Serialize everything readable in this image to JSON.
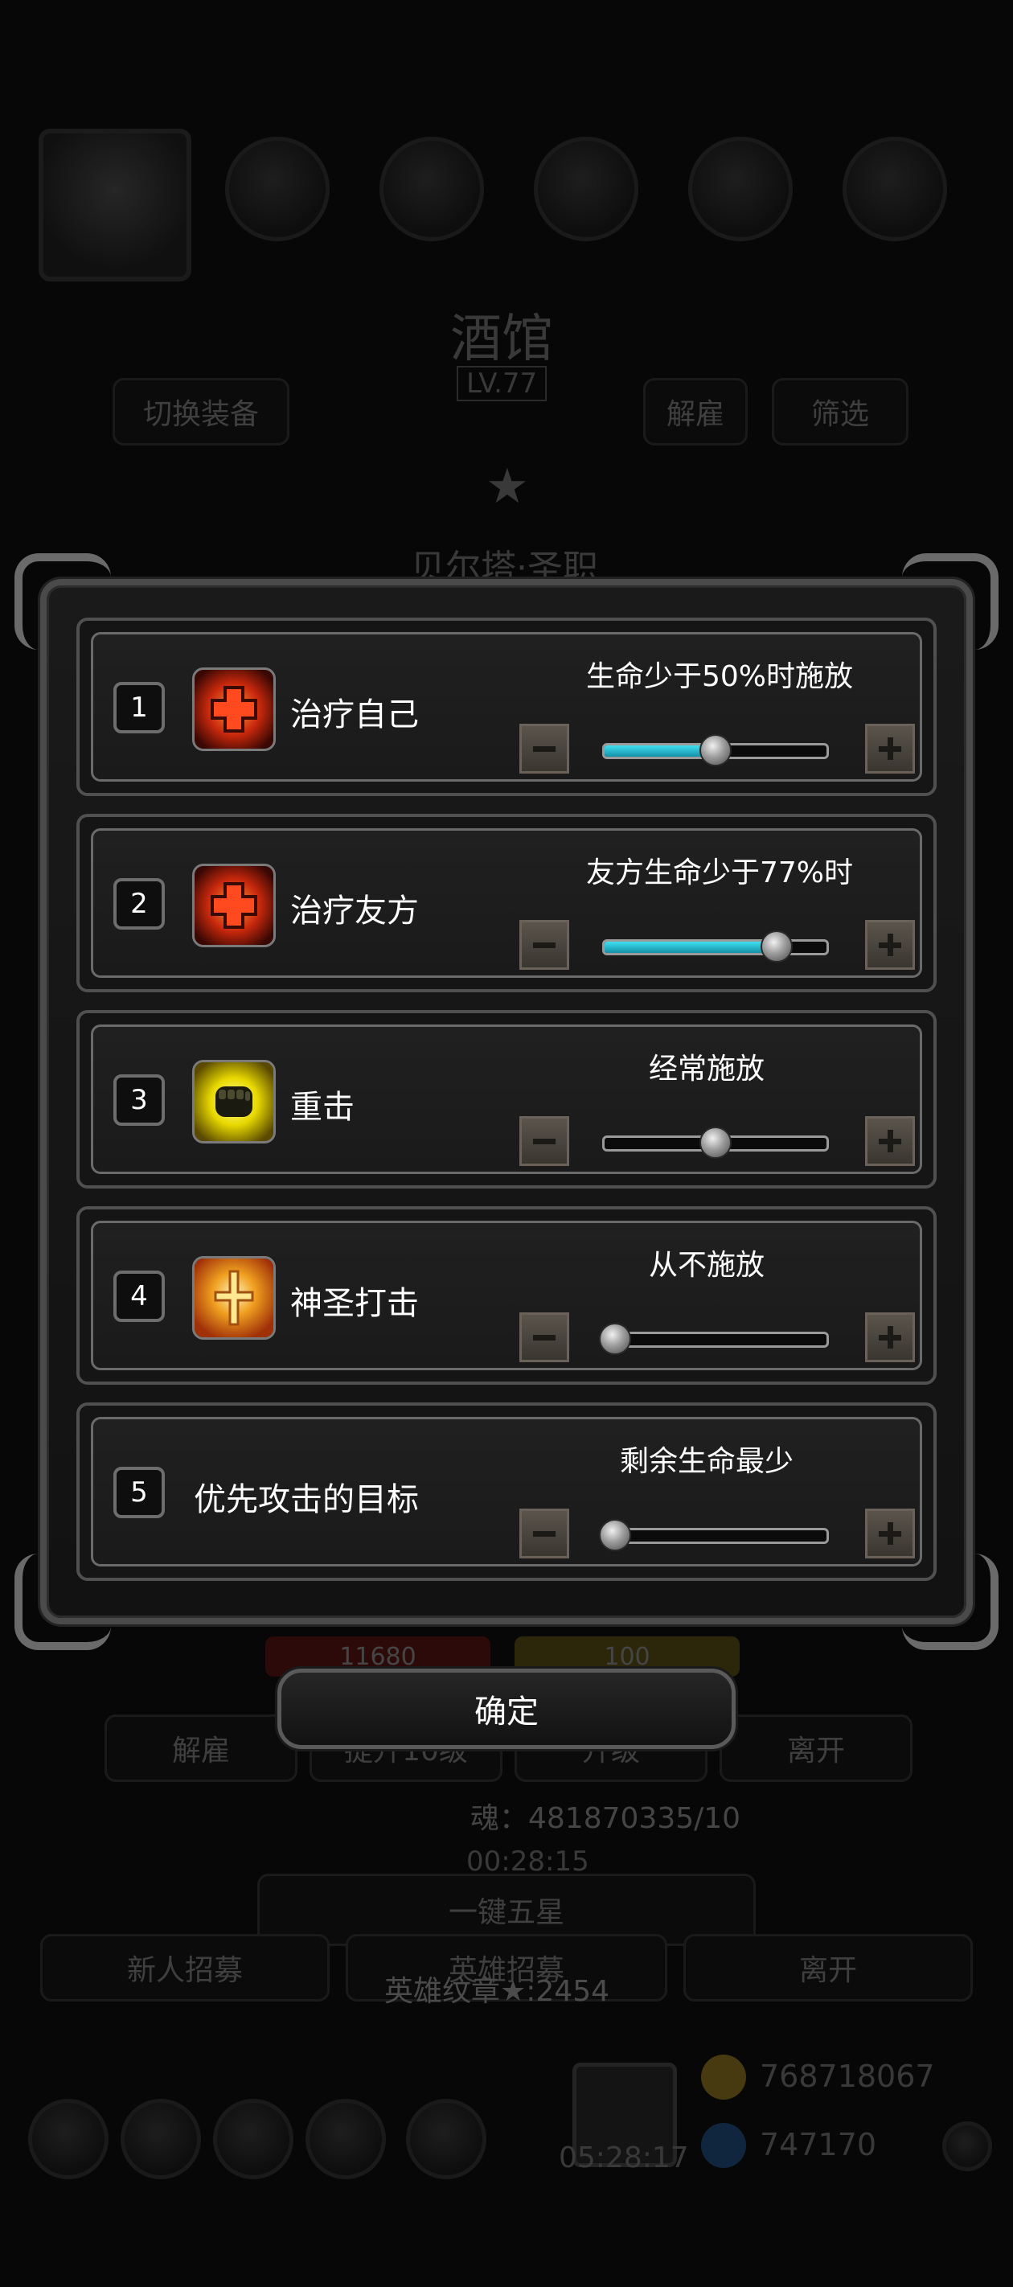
{
  "background": {
    "hero_name": "酒馆",
    "hero_level": "LV.77",
    "top_left_button": "切换装备",
    "top_right_buttons": [
      "解雇",
      "筛选"
    ],
    "hero_title": "贝尔塔·圣职",
    "hp_value": "11680",
    "energy_value": "100",
    "action_buttons": [
      "解雇",
      "提升10级",
      "升级",
      "离开"
    ],
    "soul_text": "魂：481870335/10",
    "timer_1": "00:28:15",
    "five_star_button": "一键五星",
    "recruit_button": "新人招募",
    "middle_button": "英雄招募",
    "leave_button": "离开",
    "badge_text": "英雄纹章★:2454",
    "gold_value": "768718067",
    "gem_value": "747170",
    "timer_2": "05:28:17"
  },
  "modal": {
    "rows": [
      {
        "index": "1",
        "label": "治疗自己",
        "condition": "生命少于50%时施放",
        "icon": "heal-cross-icon",
        "level": 0.5,
        "filled": true
      },
      {
        "index": "2",
        "label": "治疗友方",
        "condition": "友方生命少于77%时",
        "icon": "heal-cross-icon",
        "level": 0.77,
        "filled": true
      },
      {
        "index": "3",
        "label": "重击",
        "condition": "经常施放",
        "icon": "fist-icon",
        "level": 0.5,
        "filled": false
      },
      {
        "index": "4",
        "label": "神圣打击",
        "condition": "从不施放",
        "icon": "holy-strike-icon",
        "level": 0.0,
        "filled": false
      },
      {
        "index": "5",
        "label": "优先攻击的目标",
        "condition": "剩余生命最少",
        "icon": "",
        "level": 0.0,
        "filled": false
      }
    ],
    "confirm_label": "确定"
  }
}
